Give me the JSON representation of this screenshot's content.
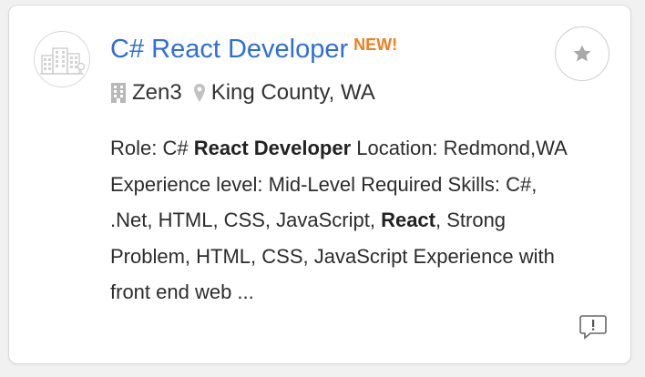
{
  "job": {
    "title": "C# React Developer",
    "badge": "NEW!",
    "company": "Zen3",
    "location": "King County, WA",
    "description": {
      "p1": "Role: C# ",
      "b1": "React Developer",
      "p2": " Location: Redmond,WA Experience level: Mid-Level Required Skills: C#, .Net, HTML, CSS, JavaScript, ",
      "b2": "React",
      "p3": ", Strong Problem, HTML, CSS, JavaScript Experience with front end web ..."
    }
  },
  "icons": {
    "logo": "company-logo-building-icon",
    "company": "building-icon",
    "location": "map-pin-icon",
    "save": "star-icon",
    "feedback": "report-speech-bubble-icon"
  },
  "colors": {
    "title": "#2f6fd6",
    "badge": "#f07f1e",
    "icon_gray": "#b8b8b8"
  }
}
